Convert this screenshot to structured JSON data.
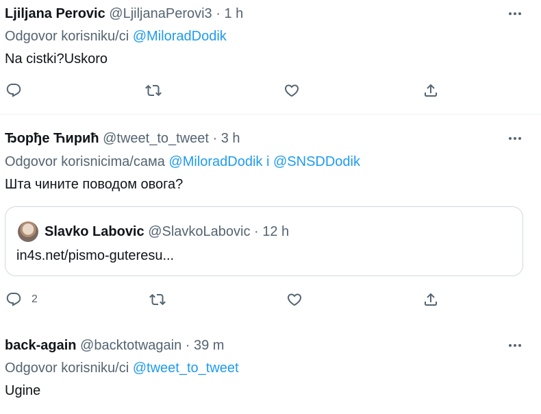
{
  "tweets": [
    {
      "name": "Ljiljana Perovic",
      "handle": "@LjiljanaPerovi3",
      "time": "· 1 h",
      "reply_prefix": "Odgovor korisniku/ci ",
      "reply_to": "@MiloradDodik",
      "text": "Na cistki?Uskoro"
    },
    {
      "name": "Ђорђе Ћирић",
      "handle": "@tweet_to_tweet",
      "time": "· 3 h",
      "reply_prefix": "Odgovor korisnicima/сама ",
      "reply_to": "@MiloradDodik",
      "reply_join": " i ",
      "reply_to_2": "@SNSDDodik",
      "text": "Шта чините поводом овога?",
      "reply_count": "2",
      "quote": {
        "name": "Slavko Labovic",
        "handle": "@SlavkoLabovic",
        "time": "· 12 h",
        "text": "in4s.net/pismo-guteresu..."
      }
    },
    {
      "name": "back-again",
      "handle": "@backtotwagain",
      "time": "· 39 m",
      "reply_prefix": "Odgovor korisniku/ci ",
      "reply_to": "@tweet_to_tweet",
      "text": "Ugine"
    }
  ],
  "icons": {
    "more": "more-icon",
    "reply": "reply-icon",
    "retweet": "retweet-icon",
    "like": "like-icon",
    "share": "share-icon"
  },
  "colors": {
    "accent": "#1d9bf0",
    "muted": "#536471",
    "text": "#0f1419"
  }
}
